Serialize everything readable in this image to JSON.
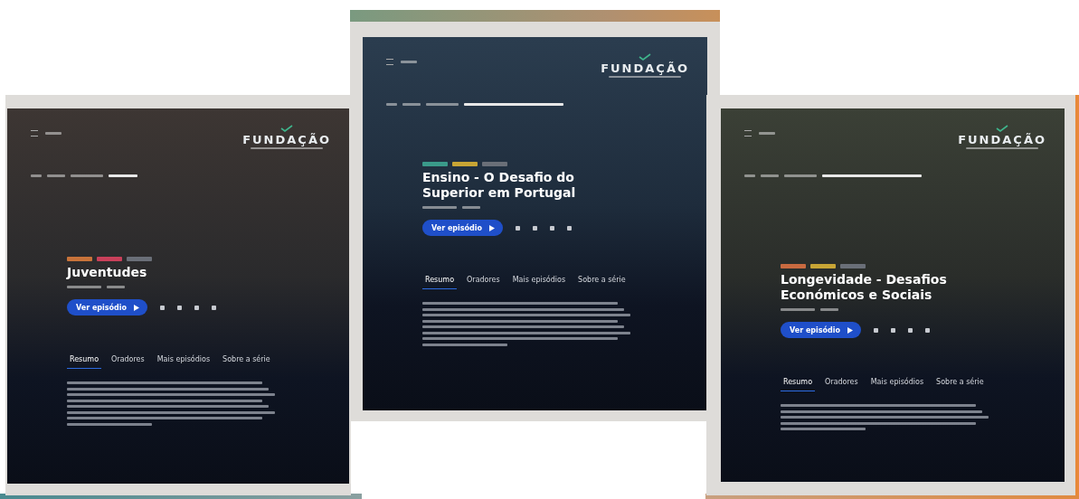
{
  "pages": [
    {
      "logo": "FUNDAÇÃO",
      "title": "Juventudes",
      "button": "Ver episódio",
      "tags": [
        {
          "color": "#c8733a"
        },
        {
          "color": "#c9405a"
        },
        {
          "color": "#6a6f78"
        }
      ],
      "tabs": [
        {
          "label": "Resumo",
          "selected": true
        },
        {
          "label": "Oradores",
          "selected": false
        },
        {
          "label": "Mais episódios",
          "selected": false
        },
        {
          "label": "Sobre a série",
          "selected": false
        }
      ]
    },
    {
      "logo": "FUNDAÇÃO",
      "title": "Ensino - O Desafio do Superior em Portugal",
      "button": "Ver episódio",
      "tags": [
        {
          "color": "#3a9a8a"
        },
        {
          "color": "#c8a535"
        },
        {
          "color": "#6a6f78"
        }
      ],
      "tabs": [
        {
          "label": "Resumo",
          "selected": true
        },
        {
          "label": "Oradores",
          "selected": false
        },
        {
          "label": "Mais episódios",
          "selected": false
        },
        {
          "label": "Sobre a série",
          "selected": false
        }
      ]
    },
    {
      "logo": "FUNDAÇÃO",
      "title": "Longevidade - Desafios Económicos e Sociais",
      "button": "Ver episódio",
      "tags": [
        {
          "color": "#c86a40"
        },
        {
          "color": "#c8a535"
        },
        {
          "color": "#6a6f78"
        }
      ],
      "tabs": [
        {
          "label": "Resumo",
          "selected": true
        },
        {
          "label": "Oradores",
          "selected": false
        },
        {
          "label": "Mais episódios",
          "selected": false
        },
        {
          "label": "Sobre a série",
          "selected": false
        }
      ]
    }
  ]
}
